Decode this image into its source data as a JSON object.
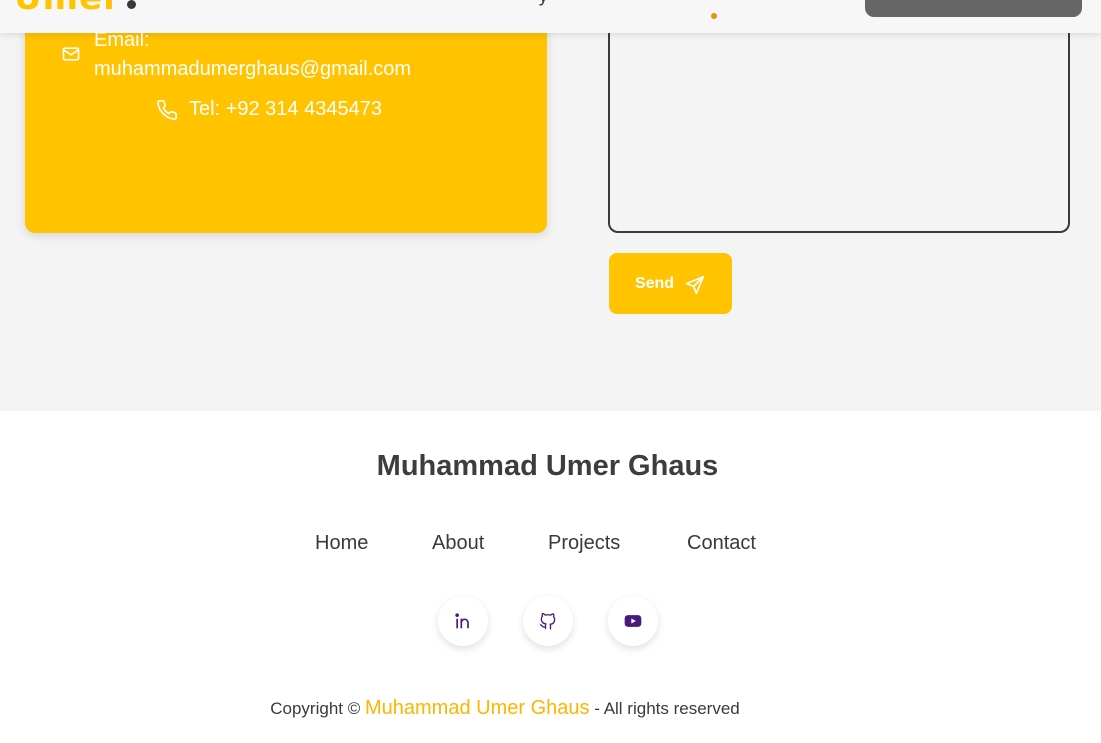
{
  "header": {
    "logo_fragment": "Umer",
    "nav_fragment": "y"
  },
  "contact": {
    "email_label": "Email:",
    "email_value": "muhammadumerghaus@gmail.com",
    "phone": "Tel: +92 314 4345473",
    "send_label": "Send"
  },
  "footer": {
    "name": "Muhammad Umer Ghaus",
    "links": [
      "Home",
      "About",
      "Projects",
      "Contact"
    ],
    "social": [
      "linkedin-icon",
      "github-icon",
      "youtube-icon"
    ],
    "copyright_prefix": "Copyright ©",
    "copyright_brand": "Muhammad Umer Ghaus",
    "copyright_suffix": "- All rights reserved"
  },
  "colors": {
    "accent": "#ffc300",
    "brand_text": "#ffb400",
    "active_dot": "#f28c00",
    "social_icon": "#4a1a7a",
    "text": "#3a3a3a"
  }
}
